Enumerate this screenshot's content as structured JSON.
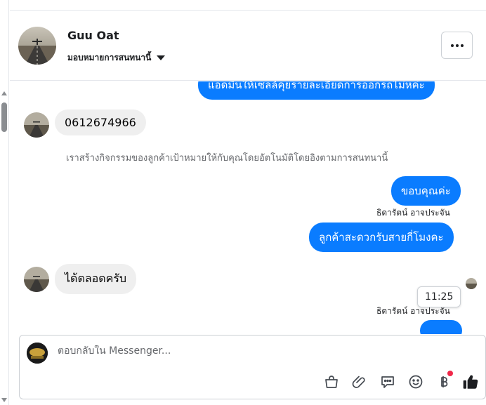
{
  "header": {
    "contact_name": "Guu Oat",
    "assign_label": "มอบหมายการสนทนานี้"
  },
  "messages": [
    {
      "kind": "outgoing",
      "text": "แอดมินให้เซลล์คุยรายละเอียดการออกรถไม่หค่ะ"
    },
    {
      "kind": "incoming",
      "text": "0612674966"
    },
    {
      "kind": "system",
      "text": "เราสร้างกิจกรรมของลูกค้าเป้าหมายให้กับคุณโดยอัตโนมัติโดยอิงตามการสนทนานี้"
    },
    {
      "kind": "outgoing",
      "text": "ขอบคุณค่ะ"
    },
    {
      "kind": "sender",
      "text": "ธิดารัตน์ อาจประจัน"
    },
    {
      "kind": "outgoing",
      "text": "ลูกค้าสะดวกรับสายกี่โมงคะ"
    },
    {
      "kind": "incoming",
      "text": "ได้ตลอดครับ"
    },
    {
      "kind": "sender",
      "text": "ธิดารัตน์ อาจประจัน"
    }
  ],
  "tooltip_time": "11:25",
  "composer": {
    "placeholder": "ตอบกลับใน Messenger...",
    "tools": [
      "shopping-bag-icon",
      "paperclip-icon",
      "chat-bubble-icon",
      "emoji-icon",
      "baht-icon",
      "thumbs-up-icon"
    ]
  },
  "colors": {
    "outgoing_bubble": "#0a7cff",
    "incoming_bubble": "#efefef",
    "badge": "#f02849"
  }
}
